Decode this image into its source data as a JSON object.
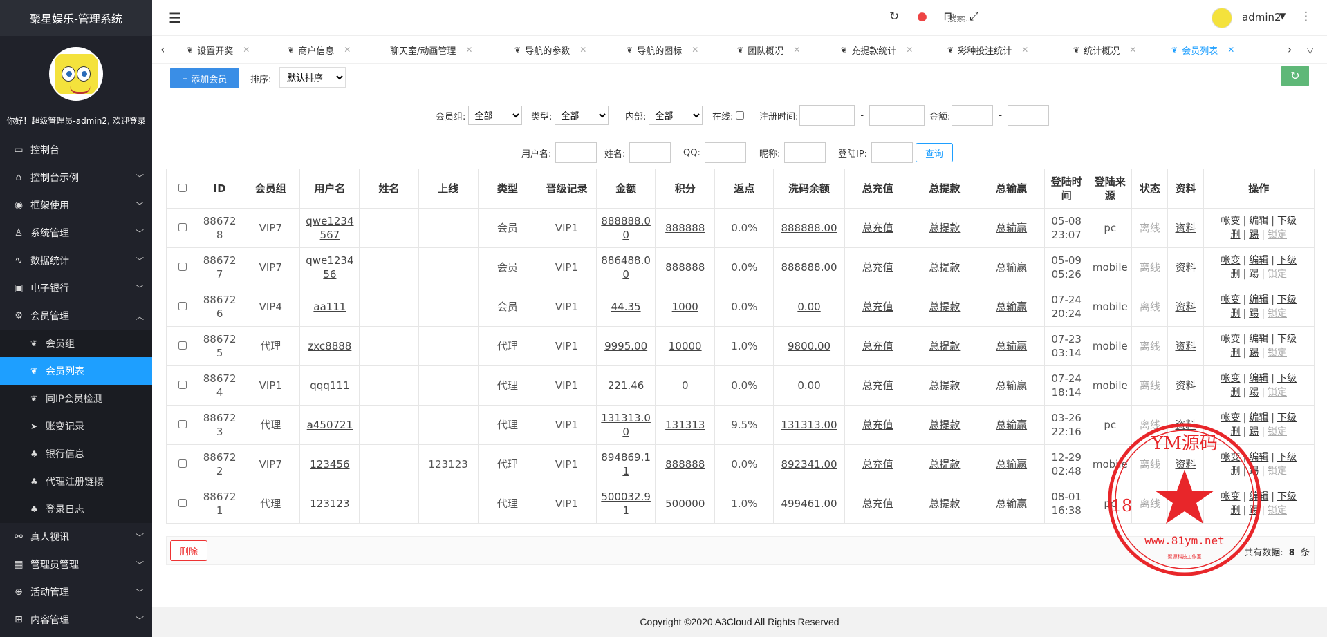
{
  "app": {
    "title": "聚星娱乐-管理系统"
  },
  "user": {
    "welcome": "你好！超级管理员-admin2, 欢迎登录",
    "name": "admin2"
  },
  "header": {
    "search_placeholder": "搜索..."
  },
  "sidebar": {
    "items": [
      {
        "label": "控制台",
        "icon": "monitor-icon",
        "glyph": "▭"
      },
      {
        "label": "控制台示例",
        "icon": "home-icon",
        "glyph": "⌂"
      },
      {
        "label": "框架使用",
        "icon": "ok-icon",
        "glyph": "◉"
      },
      {
        "label": "系统管理",
        "icon": "user-icon",
        "glyph": "♙"
      },
      {
        "label": "数据统计",
        "icon": "pulse-icon",
        "glyph": "∿"
      },
      {
        "label": "电子银行",
        "icon": "bus-icon",
        "glyph": "▣"
      },
      {
        "label": "会员管理",
        "icon": "gear-icon",
        "glyph": "⚙"
      }
    ],
    "sub_items": [
      {
        "label": "会员组",
        "icon": "feather-icon"
      },
      {
        "label": "会员列表",
        "icon": "feather-icon"
      },
      {
        "label": "同IP会员检测",
        "icon": "feather-icon"
      },
      {
        "label": "账变记录",
        "icon": "send-icon"
      },
      {
        "label": "银行信息",
        "icon": "group-icon"
      },
      {
        "label": "代理注册链接",
        "icon": "group-icon"
      },
      {
        "label": "登录日志",
        "icon": "group-icon"
      }
    ],
    "bottom_items": [
      {
        "label": "真人视讯",
        "icon": "video-icon",
        "glyph": "⚯"
      },
      {
        "label": "管理员管理",
        "icon": "grid-icon",
        "glyph": "▦"
      },
      {
        "label": "活动管理",
        "icon": "plus-circle-icon",
        "glyph": "⊕"
      },
      {
        "label": "内容管理",
        "icon": "cart-icon",
        "glyph": "⊞"
      }
    ]
  },
  "tabs": [
    "设置开奖",
    "商户信息",
    "聊天室/动画管理",
    "导航的参数",
    "导航的图标",
    "团队概况",
    "充提款统计",
    "彩种投注统计",
    "统计概况",
    "会员列表"
  ],
  "toolbar": {
    "add_label": "添加会员",
    "sort_label": "排序:",
    "sort_value": "默认排序"
  },
  "filters": {
    "group_label": "会员组:",
    "group_value": "全部",
    "type_label": "类型:",
    "type_value": "全部",
    "internal_label": "内部:",
    "internal_value": "全部",
    "online_label": "在线:",
    "regtime_label": "注册时间:",
    "dash": "-",
    "amount_label": "金额:",
    "username_label": "用户名:",
    "name_label": "姓名:",
    "qq_label": "QQ:",
    "nick_label": "昵称:",
    "ip_label": "登陆IP:",
    "query_label": "查询"
  },
  "table": {
    "headers": [
      "ID",
      "会员组",
      "用户名",
      "姓名",
      "上线",
      "类型",
      "晋级记录",
      "金额",
      "积分",
      "返点",
      "洗码余额",
      "总充值",
      "总提款",
      "总输赢",
      "登陆时间",
      "登陆来源",
      "状态",
      "资料",
      "操作"
    ],
    "rows": [
      {
        "id": "886728",
        "group": "VIP7",
        "username": "qwe1234567",
        "name": "",
        "upline": "",
        "type": "会员",
        "level": "VIP1",
        "amount": "888888.00",
        "points": "888888",
        "rebate": "0.0%",
        "wash": "888888.00",
        "recharge": "总充值",
        "withdraw": "总提款",
        "winloss": "总输赢",
        "time": "05-08 23:07",
        "source": "pc",
        "status": "离线",
        "info": "资料"
      },
      {
        "id": "886727",
        "group": "VIP7",
        "username": "qwe123456",
        "name": "",
        "upline": "",
        "type": "会员",
        "level": "VIP1",
        "amount": "886488.00",
        "points": "888888",
        "rebate": "0.0%",
        "wash": "888888.00",
        "recharge": "总充值",
        "withdraw": "总提款",
        "winloss": "总输赢",
        "time": "05-09 05:26",
        "source": "mobile",
        "status": "离线",
        "info": "资料"
      },
      {
        "id": "886726",
        "group": "VIP4",
        "username": "aa111",
        "name": "",
        "upline": "",
        "type": "会员",
        "level": "VIP1",
        "amount": "44.35",
        "points": "1000",
        "rebate": "0.0%",
        "wash": "0.00",
        "recharge": "总充值",
        "withdraw": "总提款",
        "winloss": "总输赢",
        "time": "07-24 20:24",
        "source": "mobile",
        "status": "离线",
        "info": "资料"
      },
      {
        "id": "886725",
        "group": "代理",
        "username": "zxc8888",
        "name": "",
        "upline": "",
        "type": "代理",
        "level": "VIP1",
        "amount": "9995.00",
        "points": "10000",
        "rebate": "1.0%",
        "wash": "9800.00",
        "recharge": "总充值",
        "withdraw": "总提款",
        "winloss": "总输赢",
        "time": "07-23 03:14",
        "source": "mobile",
        "status": "离线",
        "info": "资料"
      },
      {
        "id": "886724",
        "group": "VIP1",
        "username": "qqq111",
        "name": "",
        "upline": "",
        "type": "代理",
        "level": "VIP1",
        "amount": "221.46",
        "points": "0",
        "rebate": "0.0%",
        "wash": "0.00",
        "recharge": "总充值",
        "withdraw": "总提款",
        "winloss": "总输赢",
        "time": "07-24 18:14",
        "source": "mobile",
        "status": "离线",
        "info": "资料"
      },
      {
        "id": "886723",
        "group": "代理",
        "username": "a450721",
        "name": "",
        "upline": "",
        "type": "代理",
        "level": "VIP1",
        "amount": "131313.00",
        "points": "131313",
        "rebate": "9.5%",
        "wash": "131313.00",
        "recharge": "总充值",
        "withdraw": "总提款",
        "winloss": "总输赢",
        "time": "03-26 22:16",
        "source": "pc",
        "status": "离线",
        "info": "资料"
      },
      {
        "id": "886722",
        "group": "VIP7",
        "username": "123456",
        "name": "",
        "upline": "123123",
        "type": "代理",
        "level": "VIP1",
        "amount": "894869.11",
        "points": "888888",
        "rebate": "0.0%",
        "wash": "892341.00",
        "recharge": "总充值",
        "withdraw": "总提款",
        "winloss": "总输赢",
        "time": "12-29 02:48",
        "source": "mobile",
        "status": "离线",
        "info": "资料"
      },
      {
        "id": "886721",
        "group": "代理",
        "username": "123123",
        "name": "",
        "upline": "",
        "type": "代理",
        "level": "VIP1",
        "amount": "500032.91",
        "points": "500000",
        "rebate": "1.0%",
        "wash": "499461.00",
        "recharge": "总充值",
        "withdraw": "总提款",
        "winloss": "总输赢",
        "time": "08-01 16:38",
        "source": "pc",
        "status": "离线",
        "info": "资料"
      }
    ],
    "ops": {
      "change": "帐变",
      "edit": "编辑",
      "sub": "下级",
      "delete": "删",
      "kick": "踢",
      "lock": "锁定",
      "sep": "|"
    }
  },
  "bottom": {
    "delete_label": "删除",
    "total_prefix": "共有数据:",
    "total_count": "8",
    "total_suffix": "条"
  },
  "footer": {
    "copyright": "Copyright ©2020 A3Cloud All Rights Reserved"
  },
  "stamp": {
    "top_text": "YM源码",
    "url": "www.81ym.net",
    "digits": "18",
    "bottom_text": "聚源科技工作室",
    "color": "#e8262a"
  },
  "colors": {
    "sidebar_bg": "#20222a",
    "accent": "#1e9fff",
    "add_button": "#3a8ee6",
    "refresh_button": "#5fb878",
    "danger": "#e33333"
  }
}
